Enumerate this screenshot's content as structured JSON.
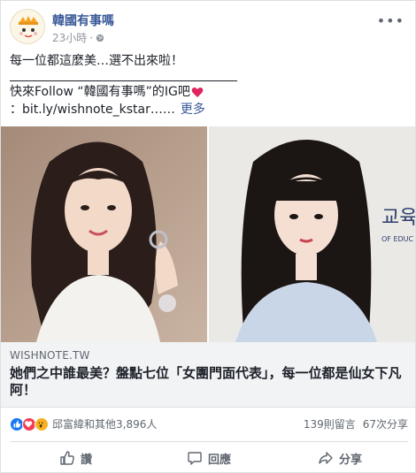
{
  "post": {
    "page_name": "韓國有事嗎",
    "time": "23小時",
    "separator": "·",
    "text_line1": "每一位都這麼美…選不出來啦！",
    "text_line2": "快來Follow “韓國有事嗎”的IG吧",
    "text_line3": "：bit.ly/wishnote_kstar……",
    "see_more": "更多"
  },
  "link": {
    "domain": "WISHNOTE.TW",
    "title": "她們之中誰最美？盤點七位「女團門面代表」，每一位都是仙女下凡阿！"
  },
  "stats": {
    "reactions_label": "邱富緯和其他3,896人",
    "comments": "139則留言",
    "shares": "67次分享"
  },
  "actions": {
    "like": "讚",
    "comment": "回應",
    "share": "分享"
  },
  "icons": {
    "more": "more-icon",
    "globe": "globe-icon",
    "heart": "heart-icon",
    "like": "like-icon",
    "comment": "comment-icon",
    "share": "share-icon"
  },
  "colors": {
    "link_blue": "#385898",
    "like_blue": "#1877f2",
    "love_red": "#f33e58",
    "wow_yellow": "#f7b125"
  }
}
